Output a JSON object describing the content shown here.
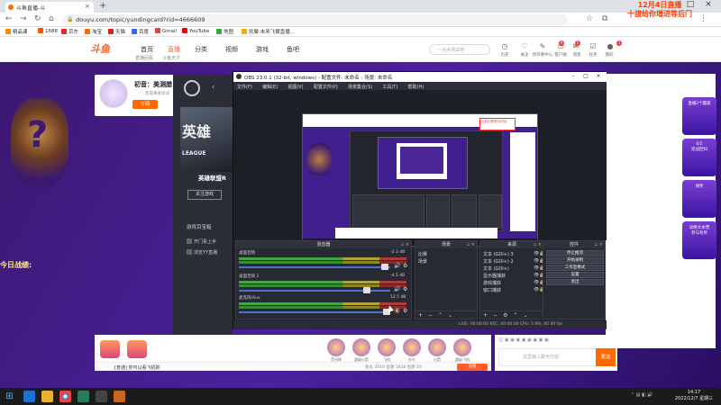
{
  "browser": {
    "tab_title": "斗鱼直播-斗",
    "url": "douyu.com/topic/yundingcard?rid=4666609",
    "bookmarks": [
      "精品课",
      "1688",
      "京东",
      "淘宝",
      "天猫",
      "百度",
      "Gmail",
      "YouTube",
      "地图",
      "欢聚·未来飞翼直播..."
    ]
  },
  "site": {
    "logo": "斗鱼",
    "nav": [
      "首页",
      "直播",
      "分类",
      "视频",
      "游戏",
      "鱼吧"
    ],
    "subnav": [
      "直播回看",
      "斗鱼天才",
      "",
      "",
      "",
      "",
      "",
      "",
      "",
      "",
      ""
    ],
    "search_placeholder": "一点点测试吧",
    "header_icons": [
      "历史",
      "关注",
      "创作者中心",
      "客户端",
      "消息",
      "任务",
      "开播",
      "我的"
    ],
    "badges": [
      "9",
      "5",
      "1"
    ],
    "promo_line1": "12月4日直播",
    "promo_line2": "十拔给你增进等后门"
  },
  "page": {
    "today_label": "今日战绩:",
    "streamer_title": "初音：美测腊",
    "streamer_sub": "欢迎来本房间",
    "follow_label": "订阅",
    "right_banners": [
      "直播2个赢家",
      "0/2",
      "逆战回归",
      "领奖",
      "攻略大本营",
      "参与有奖"
    ]
  },
  "gamecard": {
    "image_text": "英雄",
    "image_sub": "LEAGUE",
    "name": "英雄联盟R",
    "follow_btn": "关注游戏",
    "section": "游戏百宝箱",
    "items": [
      "开门看上手",
      "浏览YY直播"
    ]
  },
  "obs": {
    "title": "OBS 23.0.1 (32-bit, windows) - 配置文件: 未命名 - 场景: 未命名",
    "menu": [
      "文件(F)",
      "编辑(E)",
      "视图(V)",
      "配置文件(P)",
      "场景集合(S)",
      "工具(T)",
      "帮助(H)"
    ],
    "mixer_title": "混音器",
    "mixer": [
      {
        "name": "桌面音频",
        "db": "-2.3 dB"
      },
      {
        "name": "桌面音频 2",
        "db": "-4.5 dB"
      },
      {
        "name": "麦克风/Aux",
        "db": "12.5 dB"
      }
    ],
    "scenes_title": "场景",
    "scenes": [
      "比赛",
      "场景"
    ],
    "sources_title": "来源",
    "sources": [
      "文本 (GDI+) 3",
      "文本 (GDI+) 2",
      "文本 (GDI+)",
      "显示器捕获",
      "游戏捕获",
      "窗口捕获"
    ],
    "controls_title": "控件",
    "controls": [
      "停止推流",
      "开始录制",
      "工作室模式",
      "设置",
      "退出"
    ],
    "status": "LIVE: 00:00:00    REC: 00:00:00    CPU: 5.9%, 60.00 fps",
    "preview_label": "红色边框提示内容"
  },
  "gifts": {
    "left_items": [
      "鱼翅充值",
      "背包礼物"
    ],
    "circles": [
      "荧光棒",
      "超级火箭",
      "飞机",
      "办卡",
      "火箭",
      "超级飞机",
      "告白气球",
      "嘉年华"
    ],
    "hint": "[普通] 你可以看飞机抑",
    "stats": "鱼丸 2019    鱼翅 1828    鱼翅 20",
    "charge_btn": "充值"
  },
  "chat": {
    "placeholder": "这里输入聊天内容",
    "send": "发送"
  },
  "taskbar": {
    "time": "14:17",
    "date": "2022/12/7 星期三"
  }
}
